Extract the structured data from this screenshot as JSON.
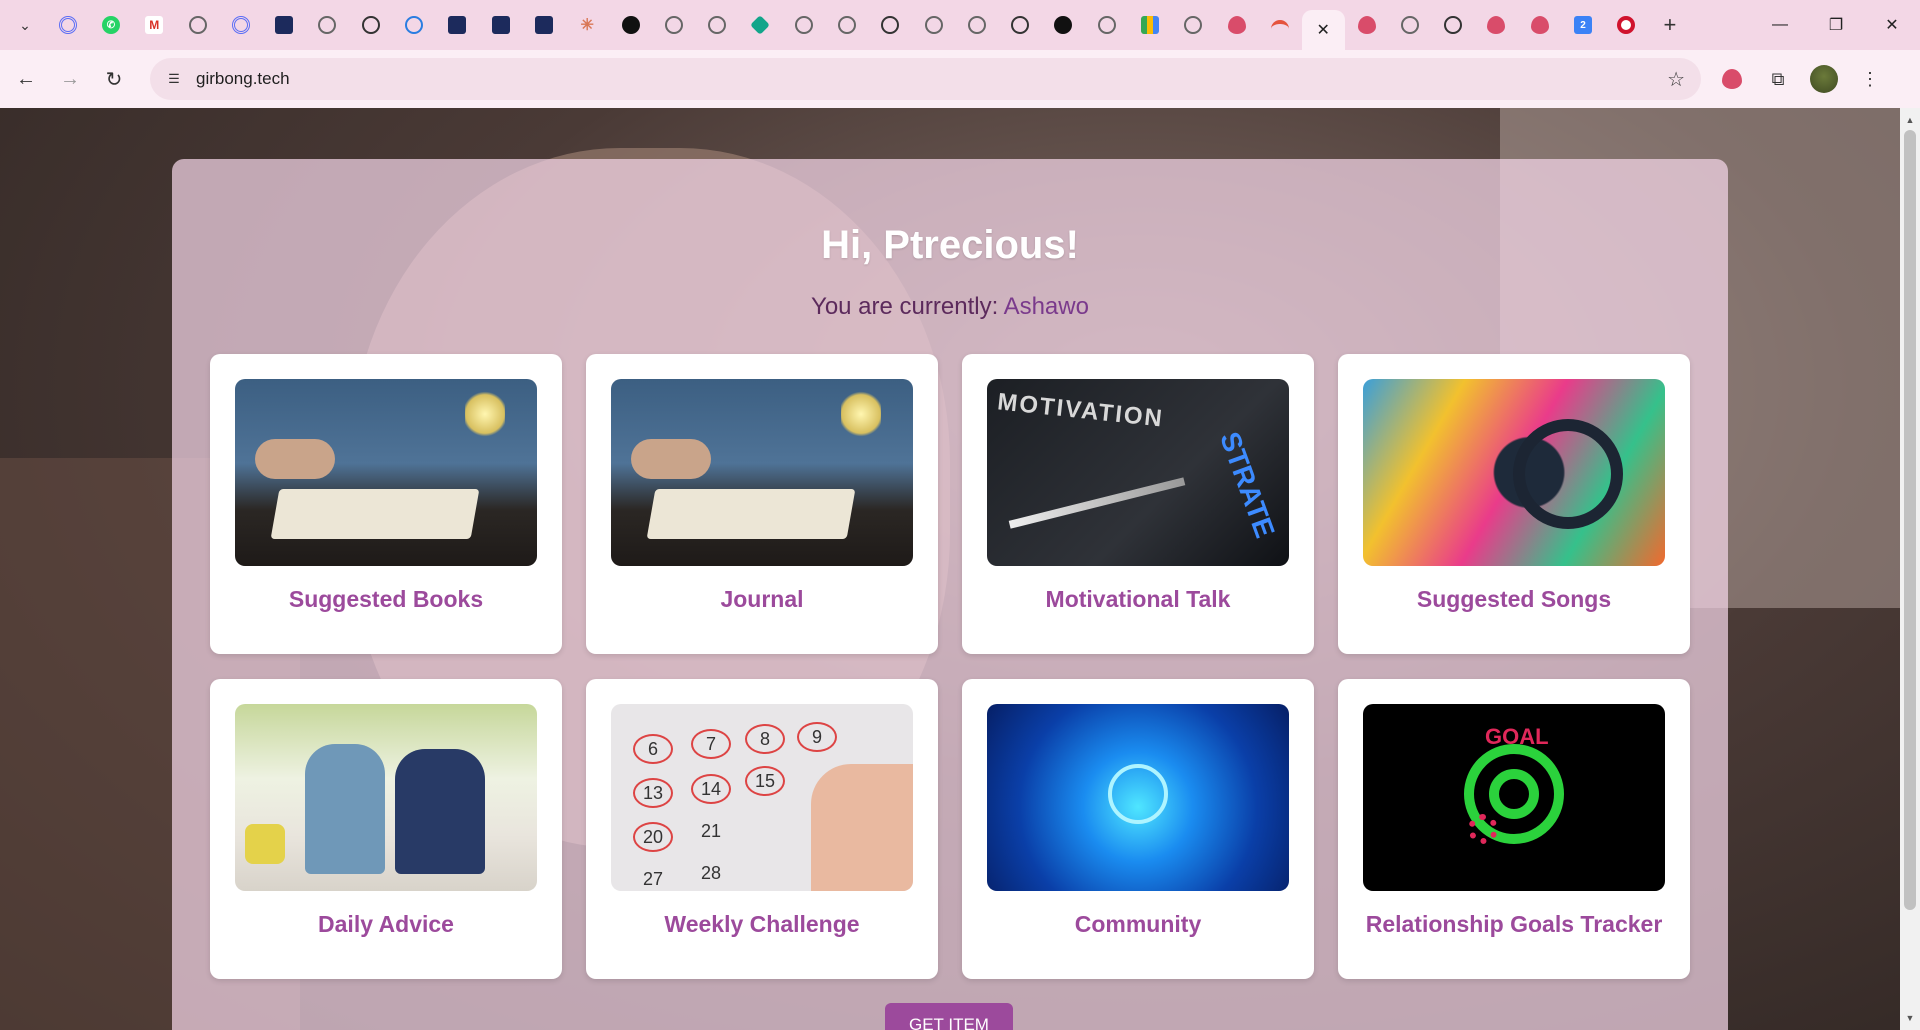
{
  "browser": {
    "tab_count": 38,
    "active_tab_index": 30,
    "tab_icons": [
      "spiral-icon",
      "spiral-icon",
      "whatsapp-icon",
      "gmail-icon",
      "globe-icon",
      "spiral-icon",
      "dark-app-icon",
      "globe-icon",
      "openai-icon",
      "blue-loop-icon",
      "dark-app-icon",
      "dark-app-icon",
      "dark-app-icon",
      "claude-icon",
      "github-icon",
      "globe-icon",
      "globe-icon",
      "diamond-icon",
      "globe-icon",
      "globe-icon",
      "openai-icon",
      "globe-icon",
      "globe-icon",
      "openai-icon",
      "github-icon",
      "globe-icon",
      "meet-icon",
      "globe-icon",
      "strawberry-icon",
      "rainbow-icon",
      "close-icon",
      "strawberry-icon",
      "globe-icon",
      "openai-icon",
      "strawberry-icon",
      "strawberry-icon",
      "number-icon",
      "target-icon"
    ],
    "url": "girbong.tech",
    "new_tab_label": "+",
    "window_controls": {
      "minimize": "—",
      "restore": "❐",
      "close": "✕"
    }
  },
  "page": {
    "greeting": "Hi, Ptrecious!",
    "status_prefix": "You are currently: ",
    "status_value": "Ashawo",
    "cards": [
      {
        "title": "Suggested Books",
        "image": "person-writing-in-notebook"
      },
      {
        "title": "Journal",
        "image": "person-writing-in-notebook"
      },
      {
        "title": "Motivational Talk",
        "image": "motivation-strategy-compass"
      },
      {
        "title": "Suggested Songs",
        "image": "colorful-headphones-splash"
      },
      {
        "title": "Daily Advice",
        "image": "elder-advising-young-man"
      },
      {
        "title": "Weekly Challenge",
        "image": "calendar-marking"
      },
      {
        "title": "Community",
        "image": "digital-community-network"
      },
      {
        "title": "Relationship Goals Tracker",
        "image": "neon-goal-target"
      }
    ],
    "calendar_numbers": [
      "6",
      "7",
      "8",
      "9",
      "13",
      "14",
      "15",
      "20",
      "21",
      "27",
      "28"
    ],
    "motivation_text": "MOTIVATION",
    "strategy_text": "STRATE",
    "goal_text": "GOAL",
    "get_button": "GET ITEM"
  },
  "colors": {
    "accent": "#9c4a9c",
    "tab_strip": "#f3d7e6",
    "toolbar": "#fbeef5",
    "panel": "#f4d6e8"
  }
}
